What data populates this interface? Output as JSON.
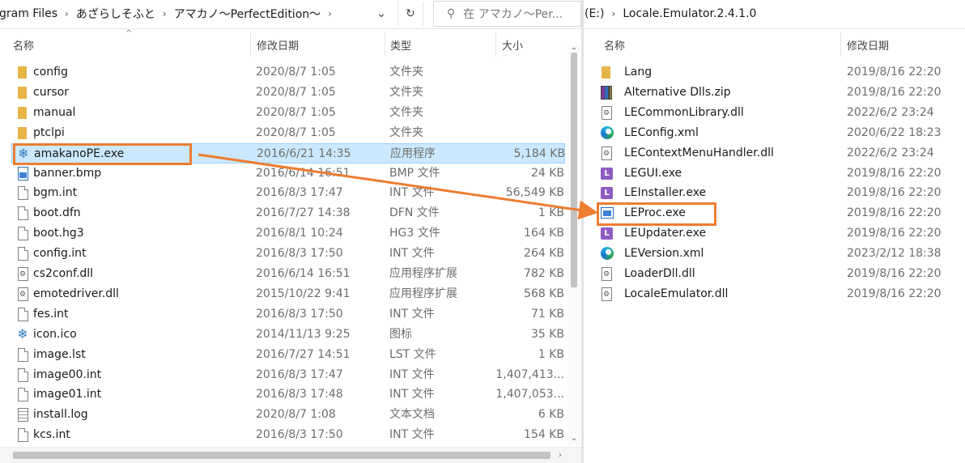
{
  "left": {
    "breadcrumbs": [
      "gram Files",
      "あざらしそふと",
      "アマカノ～PerfectEdition～"
    ],
    "search_placeholder": "在 アマカノ～Per...",
    "columns": {
      "name": "名称",
      "date": "修改日期",
      "type": "类型",
      "size": "大小"
    },
    "files": [
      {
        "icon": "folder",
        "name": "config",
        "date": "2020/8/7 1:05",
        "type": "文件夹",
        "size": ""
      },
      {
        "icon": "folder",
        "name": "cursor",
        "date": "2020/8/7 1:05",
        "type": "文件夹",
        "size": ""
      },
      {
        "icon": "folder",
        "name": "manual",
        "date": "2020/8/7 1:05",
        "type": "文件夹",
        "size": ""
      },
      {
        "icon": "folder",
        "name": "ptclpi",
        "date": "2020/8/7 1:05",
        "type": "文件夹",
        "size": ""
      },
      {
        "icon": "snow",
        "name": "amakanoPE.exe",
        "date": "2016/6/21 14:35",
        "type": "应用程序",
        "size": "5,184 KB",
        "selected": true
      },
      {
        "icon": "image",
        "name": "banner.bmp",
        "date": "2016/6/14 16:51",
        "type": "BMP 文件",
        "size": "24 KB"
      },
      {
        "icon": "file",
        "name": "bgm.int",
        "date": "2016/8/3 17:47",
        "type": "INT 文件",
        "size": "56,549 KB"
      },
      {
        "icon": "file",
        "name": "boot.dfn",
        "date": "2016/7/27 14:38",
        "type": "DFN 文件",
        "size": "1 KB"
      },
      {
        "icon": "file",
        "name": "boot.hg3",
        "date": "2016/8/1 10:24",
        "type": "HG3 文件",
        "size": "164 KB"
      },
      {
        "icon": "file",
        "name": "config.int",
        "date": "2016/8/3 17:50",
        "type": "INT 文件",
        "size": "264 KB"
      },
      {
        "icon": "gear",
        "name": "cs2conf.dll",
        "date": "2016/6/14 16:51",
        "type": "应用程序扩展",
        "size": "782 KB"
      },
      {
        "icon": "gear",
        "name": "emotedriver.dll",
        "date": "2015/10/22 9:41",
        "type": "应用程序扩展",
        "size": "568 KB"
      },
      {
        "icon": "file",
        "name": "fes.int",
        "date": "2016/8/3 17:50",
        "type": "INT 文件",
        "size": "71 KB"
      },
      {
        "icon": "snow",
        "name": "icon.ico",
        "date": "2014/11/13 9:25",
        "type": "图标",
        "size": "35 KB"
      },
      {
        "icon": "file",
        "name": "image.lst",
        "date": "2016/7/27 14:51",
        "type": "LST 文件",
        "size": "1 KB"
      },
      {
        "icon": "file",
        "name": "image00.int",
        "date": "2016/8/3 17:47",
        "type": "INT 文件",
        "size": "1,407,413..."
      },
      {
        "icon": "file",
        "name": "image01.int",
        "date": "2016/8/3 17:48",
        "type": "INT 文件",
        "size": "1,407,053..."
      },
      {
        "icon": "doc",
        "name": "install.log",
        "date": "2020/8/7 1:08",
        "type": "文本文档",
        "size": "6 KB"
      },
      {
        "icon": "file",
        "name": "kcs.int",
        "date": "2016/8/3 17:50",
        "type": "INT 文件",
        "size": "154 KB"
      }
    ]
  },
  "right": {
    "breadcrumbs": [
      "(E:)",
      "Locale.Emulator.2.4.1.0"
    ],
    "columns": {
      "name": "名称",
      "date": "修改日期"
    },
    "files": [
      {
        "icon": "folder",
        "name": "Lang",
        "date": "2019/8/16 22:20"
      },
      {
        "icon": "zip",
        "name": "Alternative Dlls.zip",
        "date": "2019/8/16 22:20"
      },
      {
        "icon": "gear",
        "name": "LECommonLibrary.dll",
        "date": "2022/6/2 23:24"
      },
      {
        "icon": "edge",
        "name": "LEConfig.xml",
        "date": "2020/6/22 18:23"
      },
      {
        "icon": "gear",
        "name": "LEContextMenuHandler.dll",
        "date": "2022/6/2 23:24"
      },
      {
        "icon": "le",
        "name": "LEGUI.exe",
        "date": "2019/8/16 22:20"
      },
      {
        "icon": "le",
        "name": "LEInstaller.exe",
        "date": "2019/8/16 22:20"
      },
      {
        "icon": "window",
        "name": "LEProc.exe",
        "date": "2019/8/16 22:20",
        "highlighted": true
      },
      {
        "icon": "le",
        "name": "LEUpdater.exe",
        "date": "2019/8/16 22:20"
      },
      {
        "icon": "edge",
        "name": "LEVersion.xml",
        "date": "2023/2/12 18:38"
      },
      {
        "icon": "gear",
        "name": "LoaderDll.dll",
        "date": "2019/8/16 22:20"
      },
      {
        "icon": "gear",
        "name": "LocaleEmulator.dll",
        "date": "2019/8/16 22:20"
      }
    ]
  },
  "colors": {
    "annotation": "#ed7d31",
    "selection": "#cce8ff"
  },
  "icons": {
    "dropdown": "chevron-down-icon",
    "refresh": "refresh-icon",
    "search": "search-icon",
    "breadcrumb_separator": "chevron-right-icon"
  }
}
